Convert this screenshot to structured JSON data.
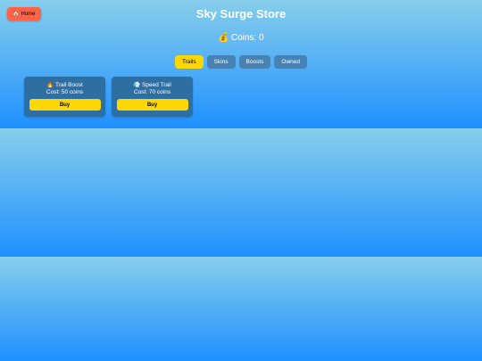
{
  "home": {
    "icon": "🏠",
    "label": "Home"
  },
  "title": "Sky Surge Store",
  "coins": {
    "icon": "💰",
    "text": "Coins: 0"
  },
  "tabs": [
    {
      "label": "Trails",
      "active": true
    },
    {
      "label": "Skins",
      "active": false
    },
    {
      "label": "Boosts",
      "active": false
    },
    {
      "label": "Owned",
      "active": false
    }
  ],
  "items": [
    {
      "icon": "🔥",
      "name": "Trail Boost",
      "cost": "Cost: 50 coins",
      "buy_label": "Buy"
    },
    {
      "icon": "💨",
      "name": "Speed Trail",
      "cost": "Cost: 70 coins",
      "buy_label": "Buy"
    }
  ],
  "colors": {
    "sky_top": "#87ceeb",
    "sky_bottom": "#1e90ff",
    "home_button": "#ff6347",
    "active_tab": "#ffd700",
    "tab": "#4682b4",
    "card": "#2e6fa3",
    "buy_button": "#ffd700"
  }
}
